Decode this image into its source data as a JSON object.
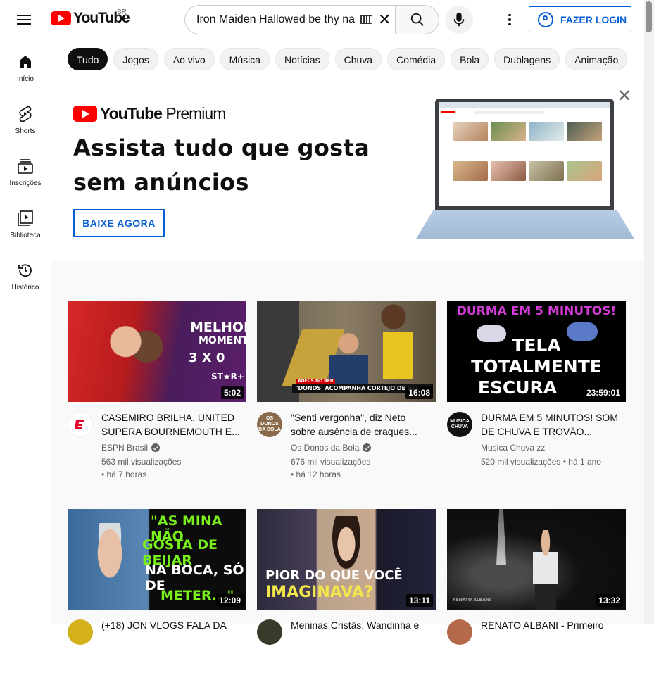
{
  "header": {
    "logo_text": "YouTube",
    "region": "BR",
    "search_value": "Iron Maiden Hallowed be thy na",
    "login_label": "FAZER LOGIN"
  },
  "sidebar": {
    "items": [
      {
        "label": "Início",
        "icon": "home-icon"
      },
      {
        "label": "Shorts",
        "icon": "shorts-icon"
      },
      {
        "label": "Inscrições",
        "icon": "subscriptions-icon"
      },
      {
        "label": "Biblioteca",
        "icon": "library-icon"
      },
      {
        "label": "Histórico",
        "icon": "history-icon"
      }
    ]
  },
  "chips": [
    "Tudo",
    "Jogos",
    "Ao vivo",
    "Música",
    "Notícias",
    "Chuva",
    "Comédia",
    "Bola",
    "Dublagens",
    "Animação"
  ],
  "banner": {
    "logo_text": "YouTube",
    "logo_suffix": "Premium",
    "title": "Assista tudo que gosta sem anúncios",
    "cta": "BAIXE AGORA"
  },
  "videos": [
    {
      "title": "CASEMIRO BRILHA, UNITED SUPERA BOURNEMOUTH E...",
      "channel": "ESPN Brasil",
      "verified": true,
      "views": "563 mil visualizações",
      "age": "há 7 horas",
      "duration": "5:02",
      "thumb_text": [
        "MELHORES",
        "MOMENTOS"
      ],
      "score": "3 x 0",
      "brand": "ST★R+"
    },
    {
      "title": "\"Senti vergonha\", diz Neto sobre ausência de craques...",
      "channel": "Os Donos da Bola",
      "verified": true,
      "views": "676 mil visualizações",
      "age": "há 12 horas",
      "duration": "16:08",
      "thumb_text": [
        "'DONOS' ACOMPANHA CORTEJO DE PEL"
      ],
      "caption_top": "ADEUS DO REI!",
      "avatar_text": "OS DONOS DA BOLA"
    },
    {
      "title": "DURMA EM 5 MINUTOS! SOM DE CHUVA E TROVÃO...",
      "channel": "Musica Chuva zz",
      "verified": false,
      "views": "520 mil visualizações",
      "age": "há 1 ano",
      "duration": "23:59:01",
      "thumb_text": [
        "DURMA EM 5 MINUTOS!",
        "TELA",
        "TOTALMENTE",
        "ESCURA"
      ],
      "avatar_text": "MUSICA CHUVA"
    },
    {
      "title": "(+18) JON VLOGS FALA DA",
      "channel": "",
      "verified": false,
      "views": "",
      "age": "",
      "duration": "12:09",
      "thumb_text": [
        "\"AS MINA NÃO",
        "GOSTA DE BEIJAR",
        "NA BOCA, SÓ DE",
        "METER...\""
      ]
    },
    {
      "title": "Meninas Cristãs, Wandinha e",
      "channel": "",
      "verified": false,
      "views": "",
      "age": "",
      "duration": "13:11",
      "thumb_text": [
        "PIOR DO QUE VOCÊ",
        "IMAGINAVA?"
      ]
    },
    {
      "title": "RENATO ALBANI - Primeiro",
      "channel": "",
      "verified": false,
      "views": "",
      "age": "",
      "duration": "13:32",
      "thumb_text": [
        "RENATO ALBANI"
      ]
    }
  ]
}
